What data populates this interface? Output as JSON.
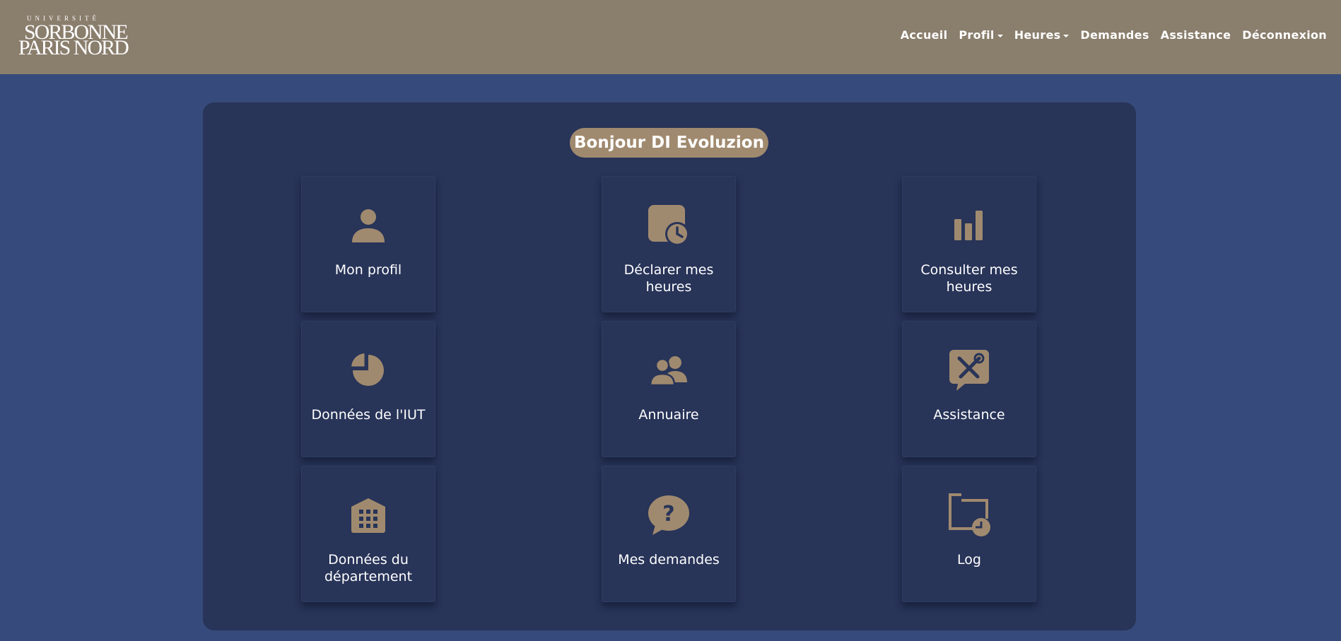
{
  "header": {
    "logo": {
      "line1": "UNIVERSITÉ",
      "line2": "SORBONNE",
      "line3": "PARIS NORD"
    },
    "nav": {
      "accueil": "Accueil",
      "profil": "Profil",
      "heures": "Heures",
      "demandes": "Demandes",
      "assistance": "Assistance",
      "deconnexion": "Déconnexion"
    }
  },
  "greeting": "Bonjour DI Evoluzion",
  "cards": [
    {
      "label": "Mon profil",
      "icon": "user-icon"
    },
    {
      "label": "Déclarer mes heures",
      "icon": "calendar-clock-icon"
    },
    {
      "label": "Consulter mes heures",
      "icon": "bar-chart-icon"
    },
    {
      "label": "Données de l'IUT",
      "icon": "pie-chart-icon"
    },
    {
      "label": "Annuaire",
      "icon": "users-icon"
    },
    {
      "label": "Assistance",
      "icon": "tools-chat-icon"
    },
    {
      "label": "Données du département",
      "icon": "building-icon"
    },
    {
      "label": "Mes demandes",
      "icon": "question-chat-icon"
    },
    {
      "label": "Log",
      "icon": "log-folder-clock-icon"
    }
  ],
  "colors": {
    "header_bg": "#8a7e6d",
    "page_bg": "#364a7b",
    "panel_bg": "#283458",
    "accent": "#a08a6f"
  }
}
